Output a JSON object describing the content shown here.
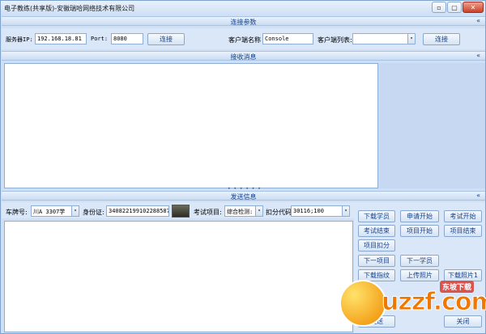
{
  "window": {
    "title": "电子教练(共享版)-安徽瑞哈网络技术有限公司",
    "controls": {
      "minimize": "▫",
      "maximize": "▢",
      "close": "✕"
    }
  },
  "connection": {
    "section_title": "连接参数",
    "collapse_glyph": "«",
    "server_ip_label": "服务器IP:",
    "server_ip_value": "192.168.18.81",
    "port_label": "Port:",
    "port_value": "8080",
    "connect_label": "连接",
    "client_name_label": "客户端名称",
    "client_name_value": "Console",
    "client_list_label": "客户端列表:",
    "client_list_value": "",
    "connect2_label": "连接"
  },
  "receive": {
    "section_title": "接收消息",
    "collapse_glyph": "«"
  },
  "send": {
    "section_title": "发送信息",
    "collapse_glyph": "«",
    "plate_label": "车牌号:",
    "plate_value": "川A 3307学",
    "id_label": "身份证:",
    "id_value": "340822199102288587",
    "exam_item_label": "考试项目:",
    "exam_item_value": "综合检测:",
    "deduct_code_label": "扣分代码:",
    "deduct_code_value": "30116;100"
  },
  "actions": {
    "download_student": "下载学员",
    "apply_start": "申请开始",
    "exam_start": "考试开始",
    "exam_end": "考试结束",
    "item_start": "项目开始",
    "item_end": "项目结束",
    "item_deduct": "项目扣分",
    "next_item": "下一项目",
    "next_student": "下一学员",
    "download_fingerprint": "下载指纹",
    "upload_photo": "上传照片",
    "download_photo": "下载照片1",
    "send": "发送",
    "close": "关闭"
  },
  "watermark": {
    "text": "uzzf.com",
    "tag": "东坡下载"
  }
}
